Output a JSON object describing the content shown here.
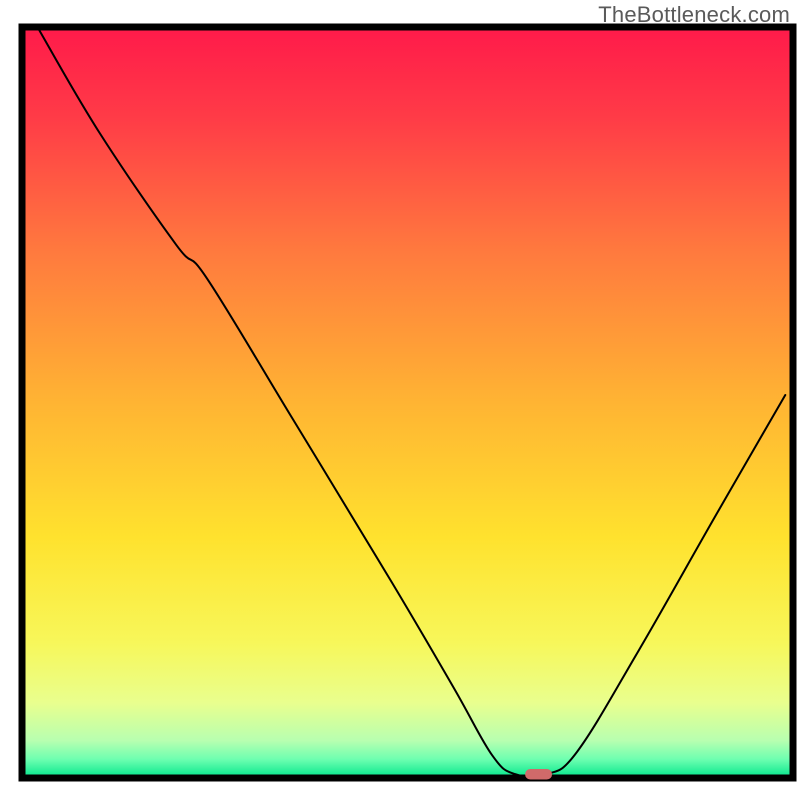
{
  "watermark": "TheBottleneck.com",
  "chart_data": {
    "type": "line",
    "title": "",
    "xlabel": "",
    "ylabel": "",
    "xlim": [
      0,
      100
    ],
    "ylim": [
      0,
      100
    ],
    "gradient_stops": [
      {
        "offset": 0.0,
        "color": "#ff1a4a"
      },
      {
        "offset": 0.12,
        "color": "#ff3b47"
      },
      {
        "offset": 0.3,
        "color": "#ff7a3e"
      },
      {
        "offset": 0.5,
        "color": "#ffb433"
      },
      {
        "offset": 0.68,
        "color": "#ffe22e"
      },
      {
        "offset": 0.82,
        "color": "#f7f75a"
      },
      {
        "offset": 0.9,
        "color": "#e9ff8e"
      },
      {
        "offset": 0.95,
        "color": "#b8ffb0"
      },
      {
        "offset": 0.975,
        "color": "#6effb0"
      },
      {
        "offset": 1.0,
        "color": "#00e58c"
      }
    ],
    "series": [
      {
        "name": "bottleneck-curve",
        "x": [
          2,
          10,
          20,
          24,
          35,
          48,
          56,
          61,
          64,
          68,
          72,
          80,
          90,
          99
        ],
        "y": [
          100,
          86,
          71,
          66.5,
          48,
          26,
          12,
          3,
          0.5,
          0.5,
          3.5,
          17,
          35,
          51
        ]
      }
    ],
    "marker": {
      "x": 67,
      "y": 0.5,
      "w": 3.5,
      "h": 1.4,
      "color": "#d06a6a"
    },
    "axis_color": "#000000",
    "curve_color": "#000000",
    "curve_width": 2.0
  }
}
